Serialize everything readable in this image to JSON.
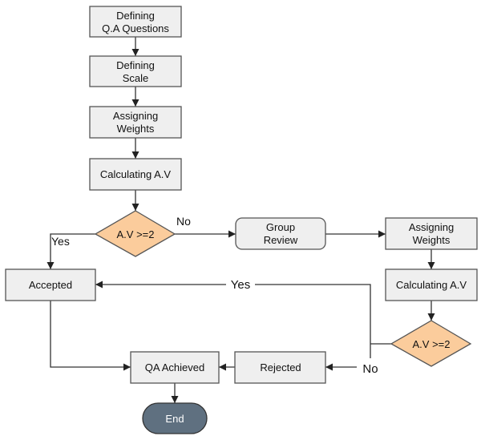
{
  "colors": {
    "process_fill": "#efefef",
    "decision_fill": "#fbcc9c",
    "terminal_fill": "#5f7080",
    "line": "#333333"
  },
  "nodes": {
    "define_questions": [
      "Defining",
      "Q.A Questions"
    ],
    "define_scale": [
      "Defining",
      "Scale"
    ],
    "assign_weights_1": [
      "Assigning",
      "Weights"
    ],
    "calc_av_1": "Calculating A.V",
    "decision_1": "A.V >=2",
    "accepted": "Accepted",
    "group_review": [
      "Group",
      "Review"
    ],
    "assign_weights_2": [
      "Assigning",
      "Weights"
    ],
    "calc_av_2": "Calculating A.V",
    "decision_2": "A.V >=2",
    "qa_achieved": "QA Achieved",
    "rejected": "Rejected",
    "end": "End"
  },
  "edge_labels": {
    "d1_yes": "Yes",
    "d1_no": "No",
    "d2_yes": "Yes",
    "d2_no": "No"
  }
}
